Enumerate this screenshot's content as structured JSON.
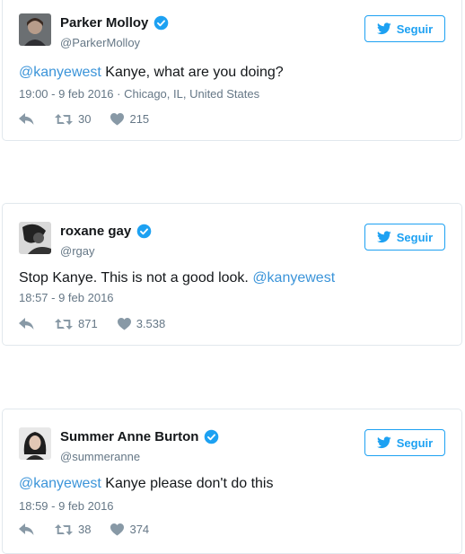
{
  "follow_label": "Seguir",
  "colors": {
    "accent": "#1da1f2",
    "link": "#3b94d9",
    "muted": "#657786",
    "border": "#e1e8ed"
  },
  "icons": {
    "verified": "verified-badge-icon",
    "twitter": "twitter-bird-icon",
    "reply": "reply-icon",
    "retweet": "retweet-icon",
    "like": "heart-icon"
  },
  "tweets": [
    {
      "name": "Parker Molloy",
      "handle": "@ParkerMolloy",
      "mention": "@kanyewest",
      "text": " Kanye, what are you doing?",
      "meta": "19:00 - 9 feb 2016 · Chicago, IL, United States",
      "retweets": "30",
      "likes": "215"
    },
    {
      "name": "roxane gay",
      "handle": "@rgay",
      "text": "Stop Kanye. This is not a good look. ",
      "mention": "@kanyewest",
      "meta": "18:57 - 9 feb 2016",
      "retweets": "871",
      "likes": "3.538"
    },
    {
      "name": "Summer Anne Burton",
      "handle": "@summeranne",
      "mention": "@kanyewest",
      "text": " Kanye please don't do this",
      "meta": "18:59 - 9 feb 2016",
      "retweets": "38",
      "likes": "374"
    }
  ]
}
